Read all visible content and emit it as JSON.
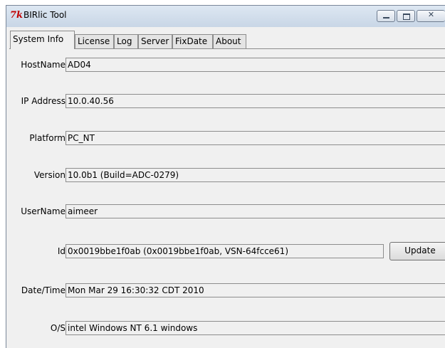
{
  "window": {
    "title": "BIRlic Tool",
    "app_icon_glyph": "7k"
  },
  "tabs": [
    {
      "label": "System Info",
      "active": true
    },
    {
      "label": "License",
      "active": false
    },
    {
      "label": "Log",
      "active": false
    },
    {
      "label": "Server",
      "active": false
    },
    {
      "label": "FixDate",
      "active": false
    },
    {
      "label": "About",
      "active": false
    }
  ],
  "fields": {
    "hostname": {
      "label": "HostName",
      "value": "AD04"
    },
    "ip_address": {
      "label": "IP Address",
      "value": "10.0.40.56"
    },
    "platform": {
      "label": "Platform",
      "value": "PC_NT"
    },
    "version": {
      "label": "Version",
      "value": "10.0b1  (Build=ADC-0279)"
    },
    "username": {
      "label": "UserName",
      "value": "aimeer"
    },
    "id": {
      "label": "Id",
      "value": "0x0019bbe1f0ab  (0x0019bbe1f0ab, VSN-64fcce61)"
    },
    "datetime": {
      "label": "Date/Time",
      "value": "Mon Mar 29 16:30:32 CDT 2010"
    },
    "os": {
      "label": "O/S",
      "value": "intel Windows NT 6.1 windows"
    }
  },
  "buttons": {
    "update": "Update"
  },
  "colors": {
    "window_bg": "#f0f0f0",
    "titlebar": "#c8d6e6",
    "app_icon": "#c00000"
  }
}
